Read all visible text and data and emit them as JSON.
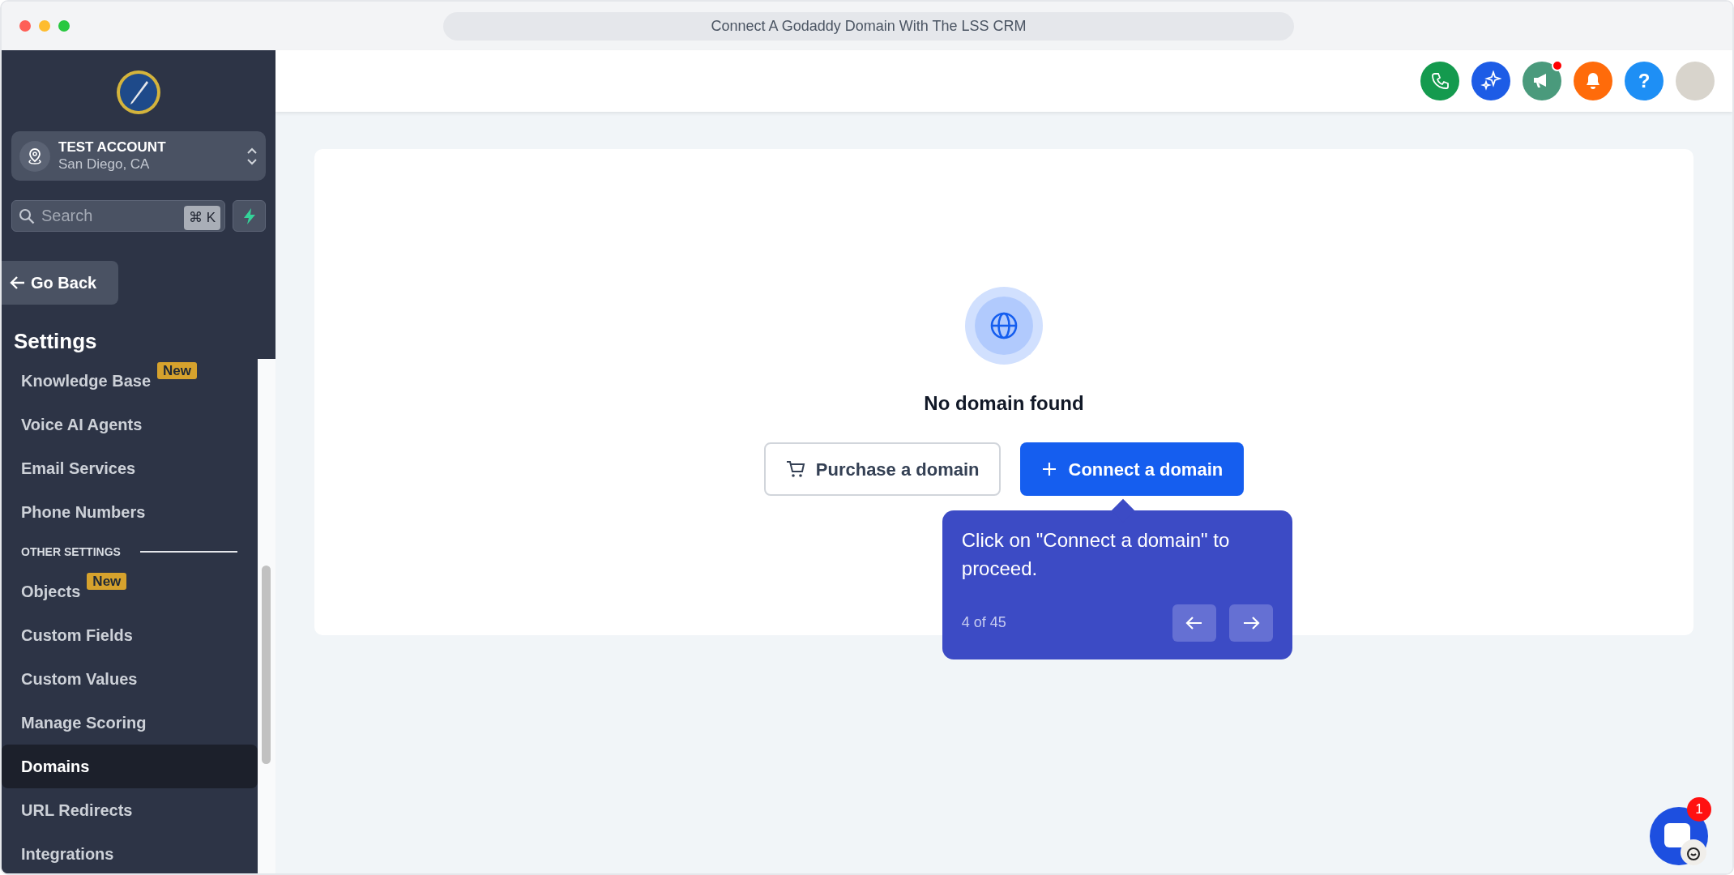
{
  "window": {
    "title": "Connect A Godaddy Domain With The LSS CRM"
  },
  "sidebar": {
    "account": {
      "name": "TEST ACCOUNT",
      "location": "San Diego, CA"
    },
    "search": {
      "placeholder": "Search",
      "shortcut": "⌘ K"
    },
    "back_button": "Go Back",
    "heading": "Settings",
    "items": [
      {
        "kind": "item",
        "label": "Knowledge Base",
        "badge": "New",
        "selected": false
      },
      {
        "kind": "item",
        "label": "Voice AI Agents",
        "selected": false
      },
      {
        "kind": "item",
        "label": "Email Services",
        "selected": false
      },
      {
        "kind": "item",
        "label": "Phone Numbers",
        "selected": false
      },
      {
        "kind": "section",
        "label": "OTHER SETTINGS"
      },
      {
        "kind": "item",
        "label": "Objects",
        "badge": "New",
        "selected": false
      },
      {
        "kind": "item",
        "label": "Custom Fields",
        "selected": false
      },
      {
        "kind": "item",
        "label": "Custom Values",
        "selected": false
      },
      {
        "kind": "item",
        "label": "Manage Scoring",
        "selected": false
      },
      {
        "kind": "item",
        "label": "Domains",
        "selected": true
      },
      {
        "kind": "item",
        "label": "URL Redirects",
        "selected": false
      },
      {
        "kind": "item",
        "label": "Integrations",
        "selected": false
      }
    ]
  },
  "header_actions": [
    {
      "kind": "phone",
      "color": "#149a4e",
      "alert": false
    },
    {
      "kind": "sparkle",
      "color": "#1d5ce6",
      "alert": false
    },
    {
      "kind": "megaphone",
      "color": "#4a9a7c",
      "alert": true
    },
    {
      "kind": "bell",
      "color": "#ff6b0a",
      "alert": false
    },
    {
      "kind": "help",
      "color": "#1e8ff5",
      "alert": false,
      "label": "?"
    },
    {
      "kind": "avatar",
      "alert": false
    }
  ],
  "empty_state": {
    "title": "No domain found",
    "buttons": [
      {
        "kind": "outline",
        "label": "Purchase a domain"
      },
      {
        "kind": "primary",
        "label": "Connect a domain"
      }
    ]
  },
  "tooltip": {
    "text": "Click on \"Connect a domain\" to proceed.",
    "counter": "4 of 45"
  },
  "chat_widget": {
    "badge": "1"
  }
}
